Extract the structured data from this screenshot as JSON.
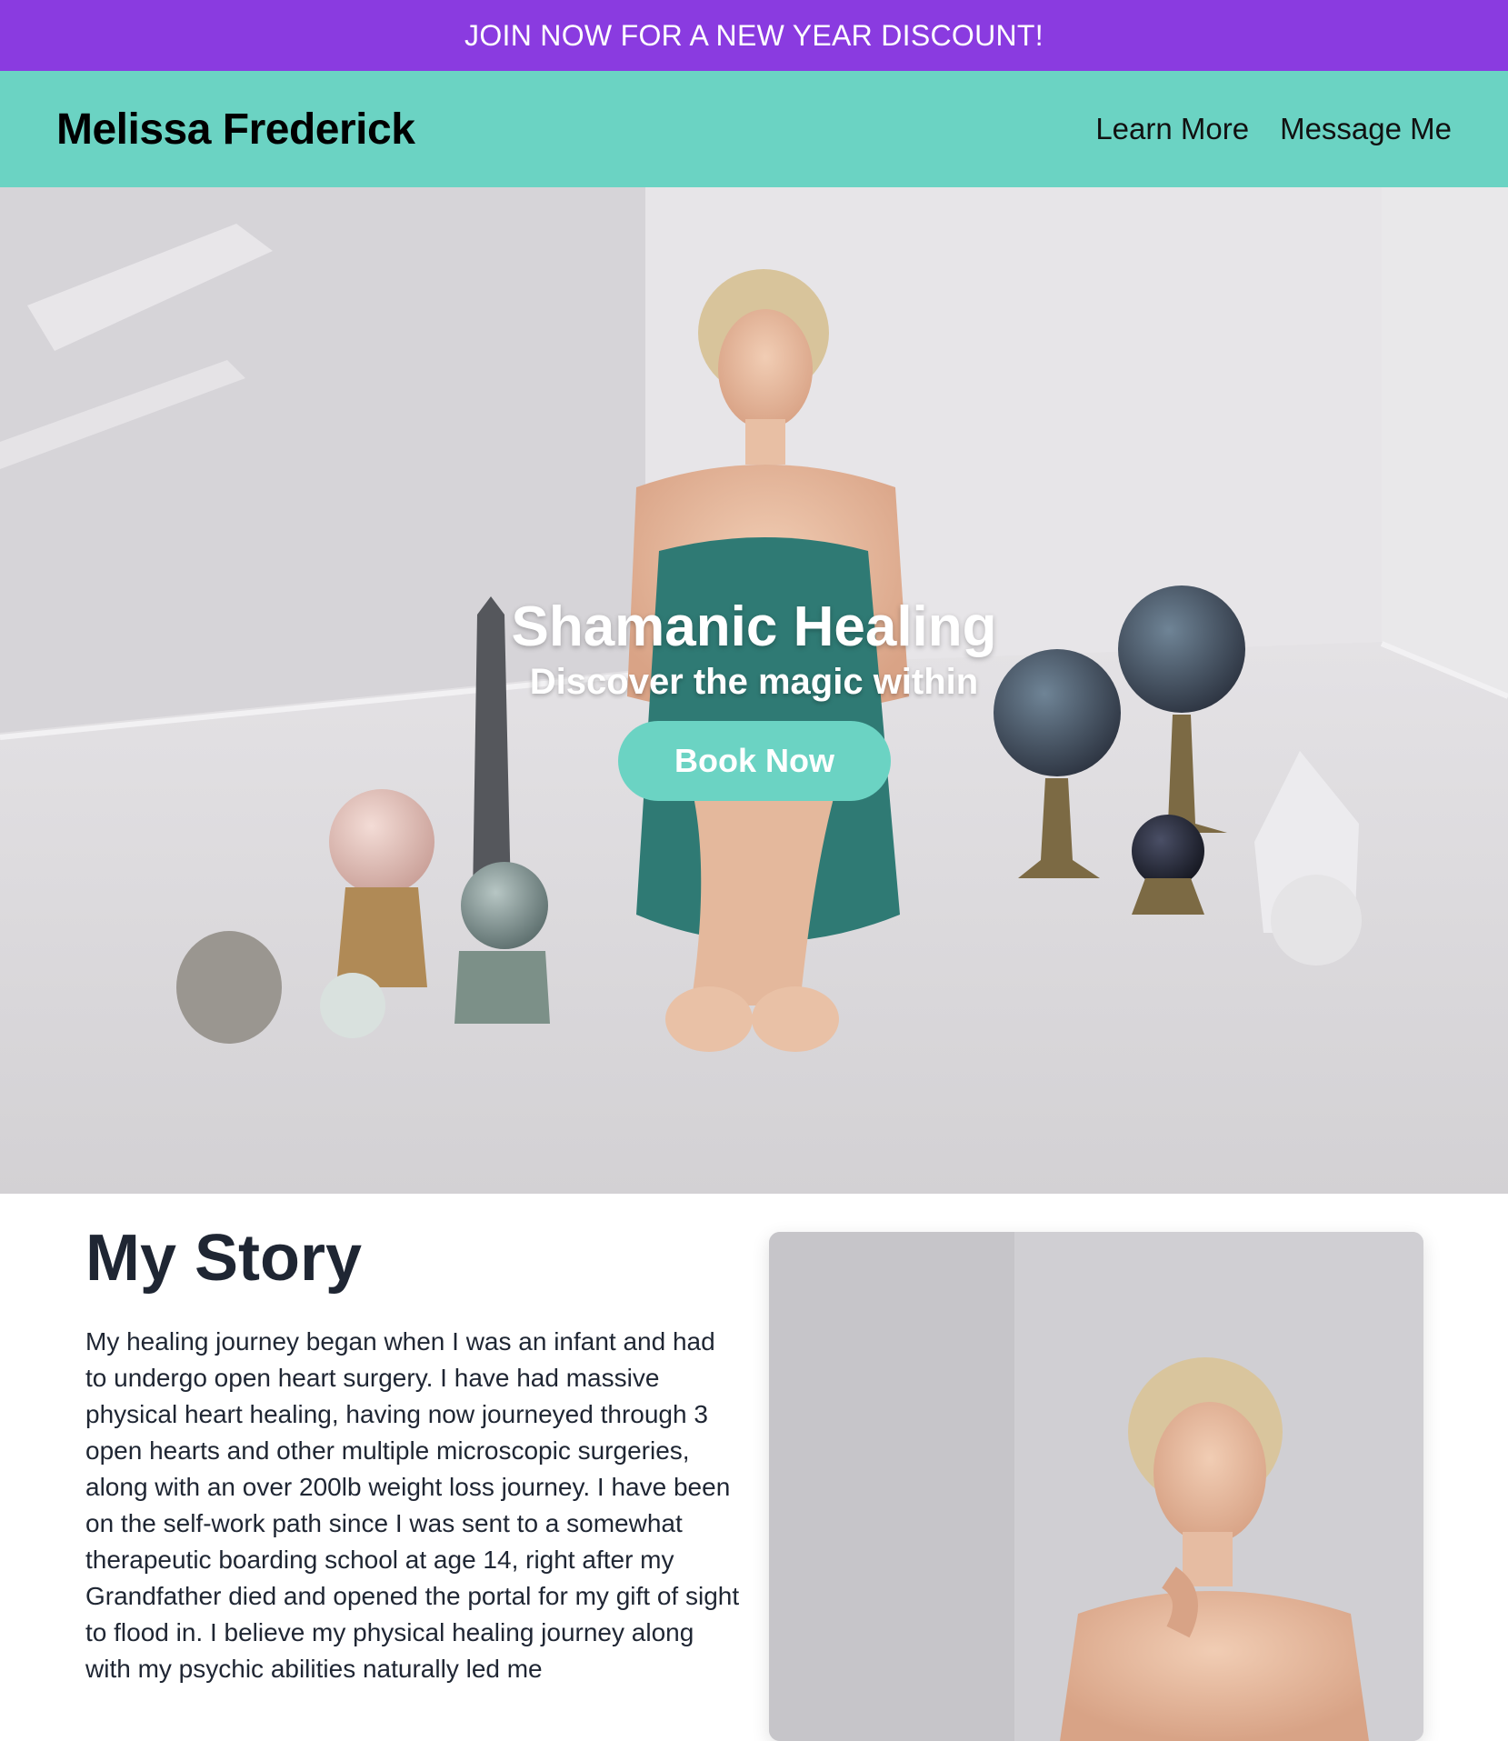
{
  "promo": {
    "text": "JOIN NOW FOR A NEW YEAR DISCOUNT!"
  },
  "nav": {
    "brand": "Melissa Frederick",
    "links": [
      {
        "label": "Learn More"
      },
      {
        "label": "Message Me"
      }
    ]
  },
  "hero": {
    "title": "Shamanic Healing",
    "subtitle": "Discover the magic within",
    "cta_label": "Book Now"
  },
  "story": {
    "title": "My Story",
    "body": "My healing journey began when I was an infant and had to undergo open heart surgery. I have had massive physical heart healing, having now journeyed through 3 open hearts and other multiple microscopic surgeries, along with an over 200lb weight loss journey. I have been on the self-work path since I was sent to a somewhat therapeutic boarding school at age 14, right after my Grandfather died and opened the portal for my gift of sight to flood in. I believe my physical healing journey along with my psychic abilities naturally led me"
  },
  "colors": {
    "promo_bg": "#8a3be0",
    "nav_bg": "#6bd3c3",
    "accent": "#6bd3c3",
    "text_dark": "#1f2633"
  }
}
